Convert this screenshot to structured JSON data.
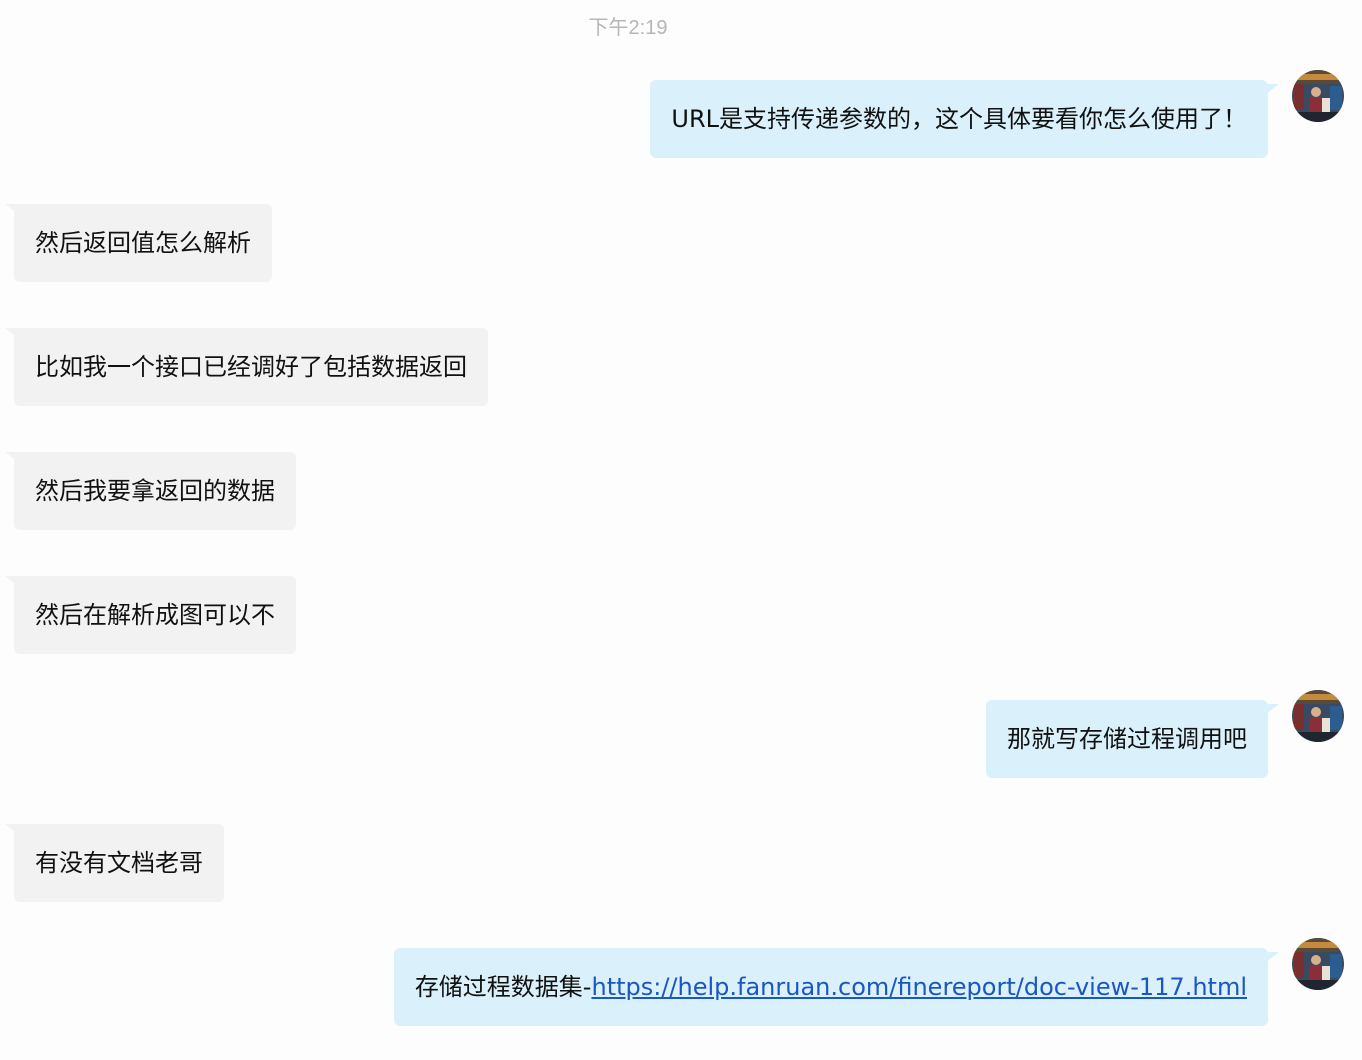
{
  "timestamp": "下午2:19",
  "messages": [
    {
      "side": "out",
      "text": "URL是支持传递参数的，这个具体要看你怎么使用了！"
    },
    {
      "side": "in",
      "text": "然后返回值怎么解析"
    },
    {
      "side": "in",
      "text": "比如我一个接口已经调好了包括数据返回"
    },
    {
      "side": "in",
      "text": "然后我要拿返回的数据"
    },
    {
      "side": "in",
      "text": "然后在解析成图可以不"
    },
    {
      "side": "out",
      "text": "那就写存储过程调用吧"
    },
    {
      "side": "in",
      "text": "有没有文档老哥"
    },
    {
      "side": "out",
      "text": "存储过程数据集-",
      "link": "https://help.fanruan.com/finereport/doc-view-117.html"
    }
  ],
  "colors": {
    "incoming_bubble": "#f2f2f2",
    "outgoing_bubble": "#daf1fb",
    "link": "#1a56c4",
    "timestamp": "#b6b6b6"
  },
  "icons": {
    "avatar": "user-avatar-photo"
  }
}
